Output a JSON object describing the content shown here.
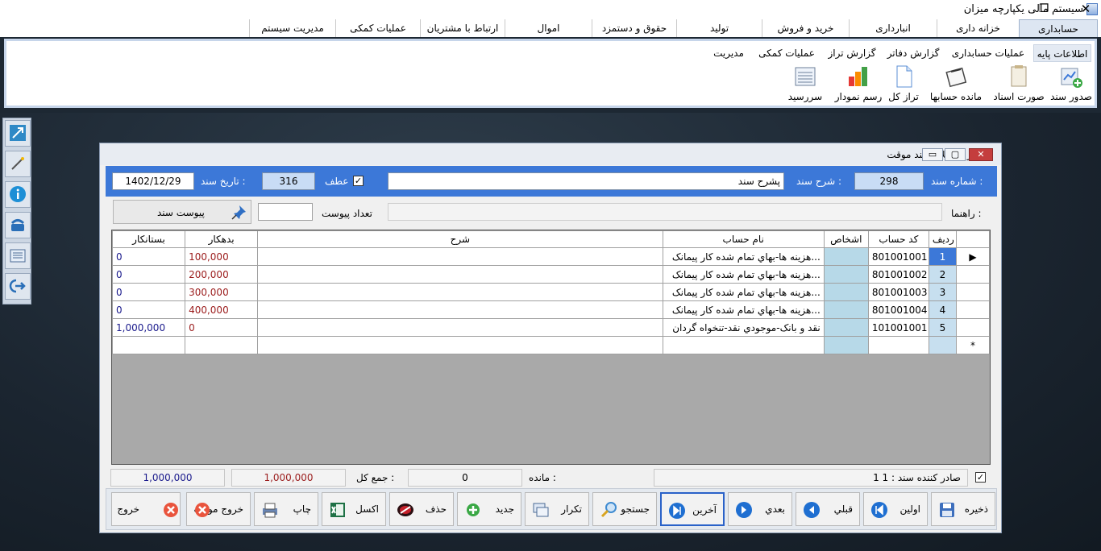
{
  "window": {
    "title": "سیستم مالی یکپارچه میزان"
  },
  "menu": {
    "tabs": [
      {
        "label": "حسابداری"
      },
      {
        "label": "خزانه داری"
      },
      {
        "label": "انبارداری"
      },
      {
        "label": "خرید و فروش"
      },
      {
        "label": "تولید"
      },
      {
        "label": "حقوق و دستمزد"
      },
      {
        "label": "اموال"
      },
      {
        "label": "ارتباط با مشتریان"
      },
      {
        "label": "عملیات کمکی"
      },
      {
        "label": "مدیریت سیستم"
      }
    ]
  },
  "ribbon": {
    "tabs": [
      {
        "label": "اطلاعات پایه"
      },
      {
        "label": "عملیات حسابداری"
      },
      {
        "label": "گزارش دفاتر"
      },
      {
        "label": "گزارش تراز"
      },
      {
        "label": "عملیات کمکی"
      },
      {
        "label": "مدیریت"
      }
    ],
    "buttons": [
      {
        "label": "صدور سند"
      },
      {
        "label": "صورت اسناد"
      },
      {
        "label": "مانده حسابها"
      },
      {
        "label": "تراز کل"
      },
      {
        "label": "رسم نمودار"
      },
      {
        "label": "سررسید"
      }
    ]
  },
  "dialog": {
    "title": "صدور و اصلاح سند موقت",
    "doc_number_label": "شماره سند :",
    "doc_number": "298",
    "doc_desc_label": "شرح سند :",
    "doc_desc": "پشرح سند",
    "atf_label": "عطف",
    "atf_checked": "✓",
    "atf_number": "316",
    "doc_date_label": "تاریخ سند :",
    "doc_date": "1402/12/29",
    "guide_label": "راهنما :",
    "attach_count_label": "تعداد پیوست",
    "attach_button": "پیوست سند",
    "grid": {
      "headers": {
        "row": "ردیف",
        "code": "کد حساب",
        "person": "اشخاص",
        "account": "نام حساب",
        "desc": "شرح",
        "debit": "بدهکار",
        "credit": "بستانکار"
      },
      "rows": [
        {
          "row": "1",
          "code": "801001001",
          "account": "هزینه ها-بهاي تمام شده کار پیمانک...",
          "debit": "100,000",
          "credit": "0"
        },
        {
          "row": "2",
          "code": "801001002",
          "account": "هزینه ها-بهاي تمام شده کار پیمانک...",
          "debit": "200,000",
          "credit": "0"
        },
        {
          "row": "3",
          "code": "801001003",
          "account": "هزینه ها-بهاي تمام شده کار پیمانک...",
          "debit": "300,000",
          "credit": "0"
        },
        {
          "row": "4",
          "code": "801001004",
          "account": "هزینه ها-بهاي تمام شده کار پیمانک...",
          "debit": "400,000",
          "credit": "0"
        },
        {
          "row": "5",
          "code": "101001001",
          "account": "نقد و بانک-موجودي نقد-تنخواه گردان",
          "debit": "0",
          "credit": "1,000,000"
        }
      ],
      "new_row_marker": "*",
      "current_row_marker": "▶"
    },
    "footer": {
      "issuer_label": "صادر کننده سند : 1 1",
      "issuer_checked": "✓",
      "balance_label": "مانده :",
      "balance": "0",
      "total_label": "جمع کل :",
      "total_debit": "1,000,000",
      "total_credit": "1,000,000"
    },
    "actions": [
      {
        "label": "ذخیره",
        "icon": "save-icon"
      },
      {
        "label": "اولین",
        "icon": "first-icon"
      },
      {
        "label": "قبلي",
        "icon": "prev-icon"
      },
      {
        "label": "بعدي",
        "icon": "next-icon"
      },
      {
        "label": "آخرین",
        "icon": "last-icon"
      },
      {
        "label": "جستجو",
        "icon": "search-icon"
      },
      {
        "label": "تکرار",
        "icon": "repeat-icon"
      },
      {
        "label": "جدید",
        "icon": "add-icon"
      },
      {
        "label": "حذف",
        "icon": "delete-icon"
      },
      {
        "label": "اکسل",
        "icon": "excel-icon"
      },
      {
        "label": "چاپ",
        "icon": "print-icon"
      },
      {
        "label": "خروج موقت",
        "icon": "temp-exit-icon"
      },
      {
        "label": "خروج",
        "icon": "exit-icon"
      }
    ]
  },
  "colors": {
    "accent": "#3c78d8",
    "debit_text": "#9b1c1c",
    "credit_text": "#1a1a8c"
  }
}
